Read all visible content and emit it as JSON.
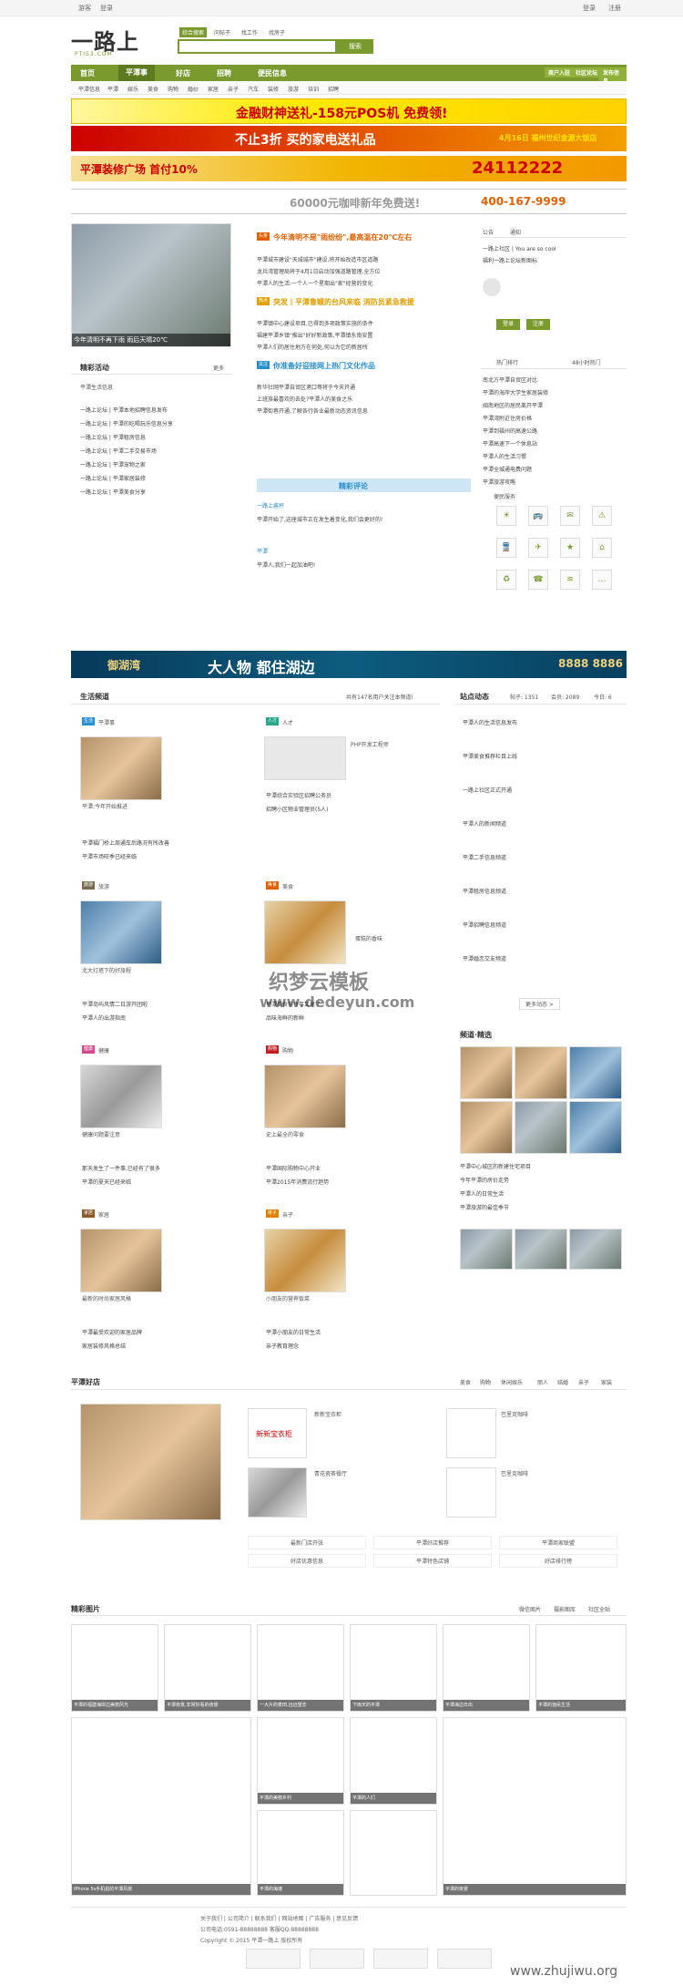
{
  "topbar": {
    "left1": "游客",
    "left2": "登录",
    "right1": "登录",
    "right2": "注册"
  },
  "logo": {
    "text": "一路上",
    "sub": "PTIS3.COM"
  },
  "search": {
    "tabs": [
      "综合搜索",
      "问帖子",
      "找工作",
      "找房子"
    ],
    "placeholder": "",
    "button": "搜索"
  },
  "nav": {
    "items": [
      "首页",
      "平潭事",
      "好店",
      "招聘",
      "便民信息"
    ],
    "right": [
      "商户入驻",
      "社区论坛",
      "发布信息"
    ]
  },
  "subnav": {
    "items": [
      "平潭信息",
      "平潭",
      "娱乐",
      "美食",
      "购物",
      "婚纱",
      "家居",
      "亲子",
      "汽车",
      "装修",
      "旅游",
      "培训",
      "招聘"
    ]
  },
  "ads": {
    "ad1": "金融财神送礼-158元POS机 免费领!",
    "ad2": "不止3折 买的家电送礼品",
    "ad2b": "4月16日 福州世纪金源大饭店",
    "ad3": "平潭装修广场 首付10%",
    "ad3b": "24112222",
    "ad4": "60000元咖啡新年免费送!",
    "ad4b": "400-167-9999",
    "mid": "大人物 都住湖边",
    "mid_brand": "御湖湾",
    "mid_phone": "8888 8886"
  },
  "slider": {
    "caption": "今年清明不再下雨 雨后天晴20℃"
  },
  "headline_list": [
    {
      "tag": "头条",
      "text": "今年清明不是\"雨纷纷\",最高温在20℃左右"
    },
    {
      "tag": "热点",
      "text": "突发丨平潭鲁鳗的台风来临 消防员紧急救援"
    },
    {
      "tag": "关注",
      "text": "你准备好迎接网上热门文化作品"
    }
  ],
  "news_lines": [
    "平潭城市建设\"天城城市\"建设,将开始改造市区道路",
    "龙兵湾管理局将于4月1日启动加强道路管理,全方位",
    "平潭人的生活:一个人一个星期出\"家\"经营的变化",
    "平潭镇中心建设项目,已得到多项政策实施的条件",
    "福建平潭乡镇\"推出\"好好新政策,平潭镇东南安置",
    "平潭人们的居住地方在何处,何以为它的新居所",
    "新华社网平潭自贸区港口等将于今天开通",
    "上班族最喜欢的去处?平潭人的美食之乐",
    "平潭街巷开通,了解各行各业最新动态资讯信息"
  ],
  "sidebar": {
    "title1": "精彩活动",
    "more": "更多",
    "title2": "平潭生活信息",
    "items": [
      "一路上论坛 | 平潭本地招聘信息发布",
      "一路上论坛 | 平潭的吃喝玩乐信息分享",
      "一路上论坛 | 平潭租房信息",
      "一路上论坛 | 平潭二手交易市场",
      "一路上论坛 | 平潭宠物之家",
      "一路上论坛 | 平潭家居装修",
      "一路上论坛 | 平潭美食分享"
    ]
  },
  "comments": {
    "title": "精彩评论",
    "user1": "一路上酱杯",
    "text1": "平潭开始了,这座城市正在发生着变化,我们会更好的!",
    "user2": "平潭",
    "text2": "平潭人,我们一起加油吧!"
  },
  "userpanel": {
    "tabs": [
      "公告",
      "通知"
    ],
    "notice1": "一路上社区 | You are so cool",
    "notice2": "福利一路上论坛新图标",
    "login": "登录",
    "register": "注册",
    "hot_title": "热门排行",
    "hot_title2": "48小时热门"
  },
  "hot_list": [
    "南北方平潭自贸区对比",
    "平潭的海岸大学生家居装修",
    "闽南地区的居民离开平潭",
    "平潭湾附近住房价格",
    "平潭到福州的高速公路",
    "平潭高速下一个休息站",
    "平潭人的生活习惯",
    "平潭全城通电费问题",
    "平潭旅游攻略"
  ],
  "services": {
    "title": "便民服务",
    "items": [
      "天气",
      "公交",
      "快递",
      "违章",
      "火车",
      "航班",
      "招聘",
      "租房",
      "二手",
      "电话",
      "wifi",
      "更多"
    ]
  },
  "life": {
    "title": "生活频道",
    "subtitle": "共有147名用户关注本频道!",
    "sections": [
      {
        "tag": "生活",
        "name": "平潭事",
        "caption": "平潭:今年开始推进",
        "line1": "平潭福门桥上周通车后路况有所改善",
        "line2": "平潭市场旺季已经来临"
      },
      {
        "tag": "人才",
        "name": "人才",
        "caption": "PHP开发工程师",
        "line1": "平潭综合实验区招聘公务员",
        "line2": "招聘小区物业管理员(5人)"
      },
      {
        "tag": "旅游",
        "name": "旅游",
        "caption": "北大灯塔下的好旅程",
        "line1": "平潭岛屿风情二日游开团啦",
        "line2": "平潭人的出游指南"
      },
      {
        "tag": "美食",
        "name": "美食",
        "caption": "蛋糕的香味",
        "line1": "平潭美食节今年又来了",
        "line2": "品味海鲜的新鲜"
      },
      {
        "tag": "健康",
        "name": "健康",
        "caption": "健康问题要注意",
        "line1": "那天发生了一件事,已经有了很多",
        "line2": "平潭的夏天已经来临"
      },
      {
        "tag": "购物",
        "name": "购物",
        "caption": "史上最全的零食",
        "line1": "平潭国际购物中心开业",
        "line2": "平潭2015年消费流行趋势"
      },
      {
        "tag": "家居",
        "name": "家居",
        "caption": "最新的时尚家居风格",
        "line1": "平潭最受欢迎的家居品牌",
        "line2": "家居装修风格总结"
      },
      {
        "tag": "亲子",
        "name": "亲子",
        "caption": "小朋友的营养饭菜",
        "line1": "平潭小朋友的日常生活",
        "line2": "亲子教育理念"
      }
    ]
  },
  "station": {
    "title": "站点动态",
    "stats": [
      "帖子: 1351",
      "会员: 2089",
      "今日: 6"
    ],
    "items": [
      "平潭人的生活信息发布",
      "平潭美食推荐栏目上线",
      "一路上社区正式开通",
      "平潭人的新闻频道",
      "平潭二手信息频道",
      "平潭租房信息频道",
      "平潭招聘信息频道",
      "平潭婚恋交友频道"
    ],
    "more": "更多动态 >"
  },
  "channel": {
    "title": "频道·精选",
    "list": [
      "平潭中心城区的新建住宅项目",
      "今年平潭的房价走势",
      "平潭人的日常生活",
      "平潭旅游的最佳季节"
    ]
  },
  "shops": {
    "title": "平潭好店",
    "tags": [
      "美食",
      "购物",
      "休闲娱乐",
      "丽人",
      "结婚",
      "亲子",
      "家装"
    ],
    "shop_names": [
      "新新宝衣柜",
      "巴里克咖啡",
      "青花瓷茶餐厅",
      "巴里克咖啡"
    ],
    "links": [
      "最新门店开张",
      "平潭好店推荐",
      "平潭商家联盟",
      "好店优惠信息",
      "平潭特色店铺",
      "好店排行榜"
    ]
  },
  "gallery": {
    "title": "精彩图片",
    "tabs": [
      "微信图片",
      "摄影图库",
      "社区全贴"
    ],
    "captions": [
      "平潭的福建海岸边美丽风光",
      "平潭夜景,非常好看的夜景",
      "一大片的麦田,远远望去",
      "下雨天的平潭",
      "平潭海边日出",
      "平潭的渔民生活",
      "iPhone 5s手机拍的平潭风景",
      "平潭的美丽乡村",
      "平潭的人们",
      "平潭的夜景",
      "平潭的海滩"
    ]
  },
  "footer": {
    "line1": "关于我们 | 公司简介 | 联系我们 | 网站地图 | 广告服务 | 意见反馈",
    "line2": "公司电话:0591-88888888  客服QQ:88888888",
    "line3": "Copyright © 2015 平潭一路上 版权所有"
  },
  "watermark": {
    "text": "织梦云模板",
    "url": "www.dedeyun.com",
    "site": "www.zhujiwu.org"
  }
}
